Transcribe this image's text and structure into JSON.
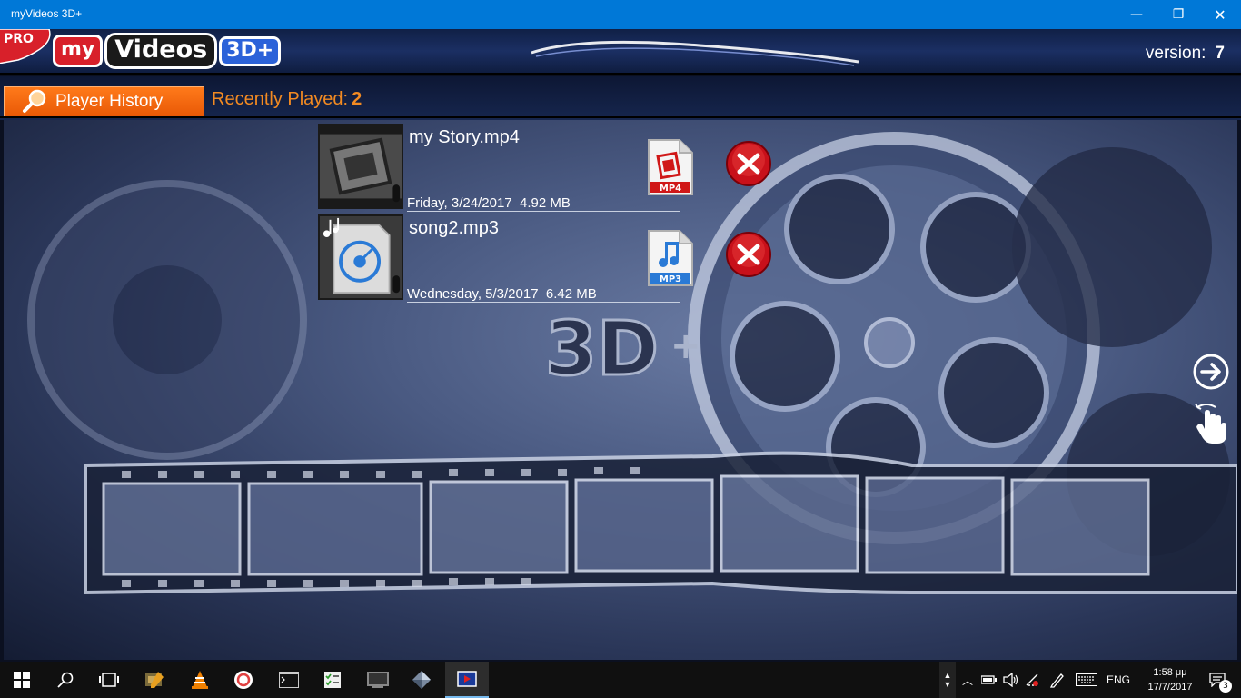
{
  "window": {
    "title": "myVideos 3D+",
    "minimize_glyph": "—",
    "restore_glyph": "❐",
    "close_glyph": "✕"
  },
  "header": {
    "pro_badge": "PRO",
    "logo_my": "my",
    "logo_videos": "Videos",
    "logo_3d": "3D+",
    "version_label": "version:",
    "version_value": "7"
  },
  "toolbar": {
    "history_button_label": "Player History",
    "recent_label": "Recently Played:",
    "recent_count": "2"
  },
  "history": [
    {
      "name": "my Story.mp4",
      "date": "Friday, 3/24/2017",
      "size": "4.92 MB",
      "type_badge": "MP4",
      "type_icon": "film-icon"
    },
    {
      "name": "song2.mp3",
      "date": "Wednesday, 5/3/2017",
      "size": "6.42 MB",
      "type_badge": "MP3",
      "type_icon": "music-note-icon"
    }
  ],
  "watermark": {
    "text": "3D",
    "plus": "+"
  },
  "taskbar": {
    "lang": "ENG",
    "time": "1:58 μμ",
    "date": "17/7/2017",
    "notification_count": "3"
  },
  "colors": {
    "titlebar": "#0078d7",
    "accent_orange": "#f28a22",
    "delete_red": "#c8101a"
  }
}
